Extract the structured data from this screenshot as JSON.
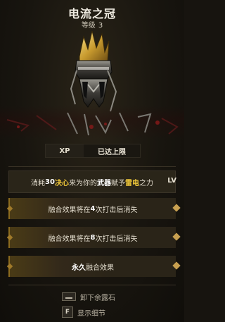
{
  "item": {
    "name": "电流之冠",
    "level_label": "等级",
    "level_value": "3"
  },
  "xp": {
    "label": "XP",
    "status": "已达上限"
  },
  "effects": {
    "primary": {
      "t1": "消耗",
      "cost": "30",
      "resource": "决心",
      "t2": "来为你的",
      "weapon": "武器",
      "t3": "赋予",
      "element": "雷电",
      "t4": "之力",
      "side_tag": "LV"
    },
    "rows": [
      {
        "t1": "融合效果将在",
        "n": "4",
        "t2": "次打击后消失"
      },
      {
        "t1": "融合效果将在",
        "n": "8",
        "t2": "次打击后消失"
      },
      {
        "t1": "",
        "n": "永久",
        "t2": "融合效果"
      }
    ]
  },
  "actions": {
    "remove": {
      "key": "",
      "label": "卸下余露石"
    },
    "details": {
      "key": "F",
      "label": "显示细节"
    }
  },
  "colors": {
    "accent": "#f0c83a",
    "border_gold": "#8a6a1e"
  }
}
